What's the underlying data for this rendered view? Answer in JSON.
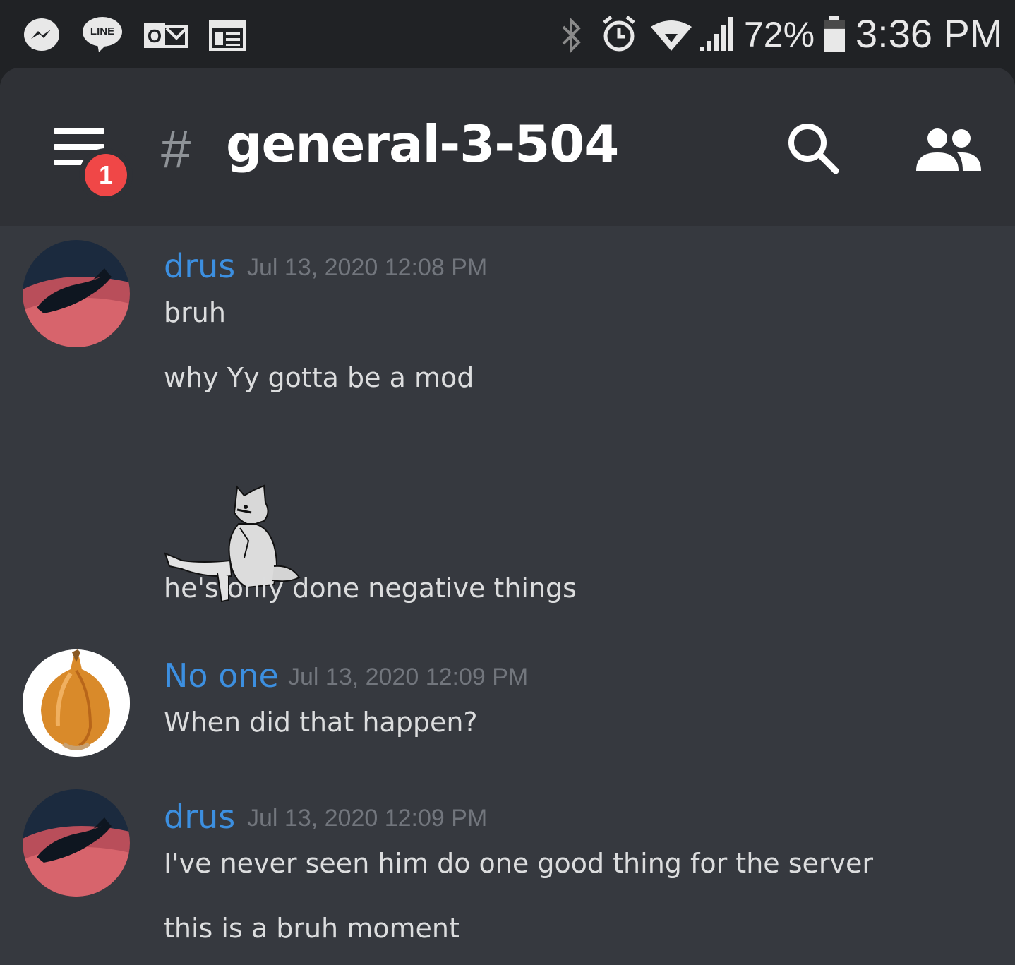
{
  "status_bar": {
    "notification_icons": [
      "messenger-icon",
      "line-icon",
      "outlook-icon",
      "calendar-icon"
    ],
    "line_label": "LINE",
    "outlook_label": "O",
    "system_icons": [
      "bluetooth-icon",
      "alarm-icon",
      "wifi-icon",
      "signal-icon"
    ],
    "battery_percent": "72%",
    "battery_level": 0.72,
    "time": "3:36 PM"
  },
  "header": {
    "unread_badge": "1",
    "channel_hash": "#",
    "channel_name": "general-3-504"
  },
  "colors": {
    "background": "#36393f",
    "header_bg": "#2f3136",
    "username": "#3c8fe0",
    "timestamp": "#72767d",
    "badge": "#f04747"
  },
  "messages": [
    {
      "author": "drus",
      "timestamp": "Jul 13, 2020 12:08 PM",
      "lines": [
        "bruh",
        "why Yy gotta be a mod"
      ],
      "sticker": "sitting-wolf-sticker",
      "after_sticker": "he's only done negative things"
    },
    {
      "author": "No one",
      "timestamp": "Jul 13, 2020 12:09 PM",
      "lines": [
        "When did that happen?"
      ]
    },
    {
      "author": "drus",
      "timestamp": "Jul 13, 2020 12:09 PM",
      "lines": [
        "I've never seen him do one good thing for the server",
        "this is a bruh moment"
      ]
    }
  ]
}
